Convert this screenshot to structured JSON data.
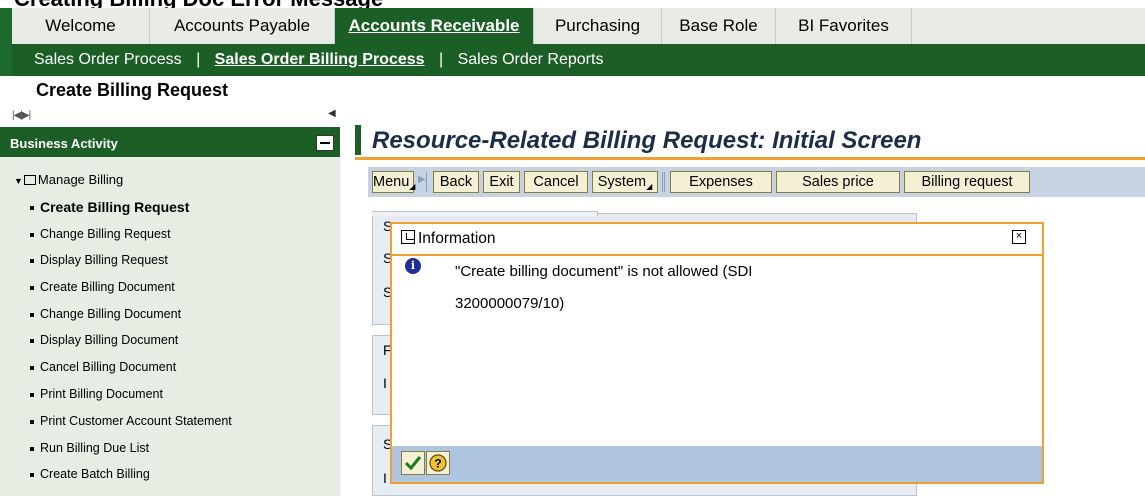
{
  "top_cut_title": "Creating Billing Doc Error Message",
  "tabs": [
    {
      "label": "Welcome"
    },
    {
      "label": "Accounts Payable"
    },
    {
      "label": "Accounts Receivable"
    },
    {
      "label": "Purchasing"
    },
    {
      "label": "Base Role"
    },
    {
      "label": "BI Favorites"
    }
  ],
  "subnav": {
    "items": [
      "Sales Order Process",
      "Sales Order Billing Process",
      "Sales Order Reports"
    ],
    "separator": "|",
    "active_index": 1
  },
  "page_title": "Create Billing Request",
  "collapse_glyph": "|◀|▶|",
  "left_panel": {
    "title": "Business Activity",
    "group_label": "Manage Billing",
    "items": [
      "Create Billing Request",
      "Change Billing Request",
      "Display Billing Request",
      "Create Billing Document",
      "Change Billing Document",
      "Display Billing Document",
      "Cancel Billing Document",
      "Print Billing Document",
      "Print Customer Account Statement",
      "Run Billing Due List",
      "Create Batch Billing"
    ],
    "selected_index": 0
  },
  "main": {
    "title": "Resource-Related Billing Request: Initial Screen"
  },
  "toolbar": {
    "menu": "Menu",
    "back": "Back",
    "exit": "Exit",
    "cancel": "Cancel",
    "system": "System",
    "expenses": "Expenses",
    "sales_price": "Sales price",
    "billing_request": "Billing request"
  },
  "bg_form": {
    "fragments": [
      "S",
      "S",
      "S",
      "F",
      "I",
      "S",
      "I"
    ]
  },
  "popup": {
    "title": "Information",
    "close_glyph": "×",
    "info_glyph": "i",
    "message_line1": "\"Create billing document\" is not allowed (SDI",
    "message_line2": "3200000079/10)"
  },
  "colors": {
    "sap_green": "#1c5f26",
    "orange_accent": "#f0a030",
    "toolbar_blue": "#c6d3e3",
    "footer_blue": "#aec4df",
    "left_panel_bg": "#e8ede3"
  },
  "icons": {
    "popup_title": "window-icon",
    "info": "info-icon",
    "ok": "checkmark-icon",
    "help": "help-icon"
  }
}
